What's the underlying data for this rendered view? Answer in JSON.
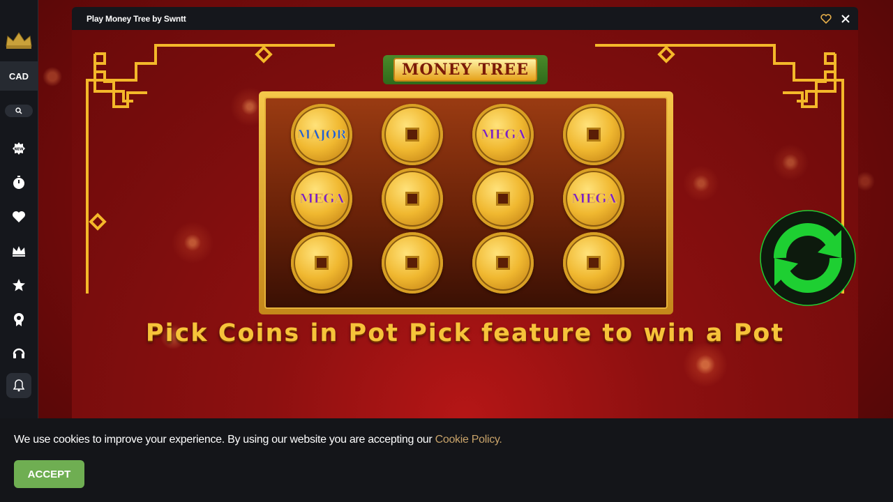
{
  "sidebar": {
    "currency": "CAD",
    "items": [
      {
        "icon": "new-badge-icon"
      },
      {
        "icon": "stopwatch-icon"
      },
      {
        "icon": "heart-icon"
      },
      {
        "icon": "crown-icon"
      },
      {
        "icon": "star-icon"
      },
      {
        "icon": "award-ribbon-icon"
      },
      {
        "icon": "headset-icon"
      },
      {
        "icon": "bell-icon"
      }
    ]
  },
  "modal": {
    "title": "Play Money Tree by Swntt"
  },
  "game": {
    "logo": "MONEY TREE",
    "coins": [
      {
        "label": "MAJOR",
        "kind": "major"
      },
      {
        "label": "",
        "kind": "plain"
      },
      {
        "label": "MEGA",
        "kind": "mega"
      },
      {
        "label": "",
        "kind": "plain"
      },
      {
        "label": "MEGA",
        "kind": "mega"
      },
      {
        "label": "",
        "kind": "plain"
      },
      {
        "label": "",
        "kind": "plain"
      },
      {
        "label": "MEGA",
        "kind": "mega"
      },
      {
        "label": "",
        "kind": "plain"
      },
      {
        "label": "",
        "kind": "plain"
      },
      {
        "label": "",
        "kind": "plain"
      },
      {
        "label": "",
        "kind": "plain"
      }
    ],
    "caption": "Pick Coins in Pot Pick feature to win a Pot"
  },
  "cookie": {
    "text": "We use cookies to improve your experience. By using our website you are accepting our",
    "link": "Cookie Policy.",
    "accept": "ACCEPT"
  },
  "colors": {
    "accent_green": "#6fae52",
    "link_gold": "#c8a36a",
    "refresh_green": "#1ecf32"
  }
}
